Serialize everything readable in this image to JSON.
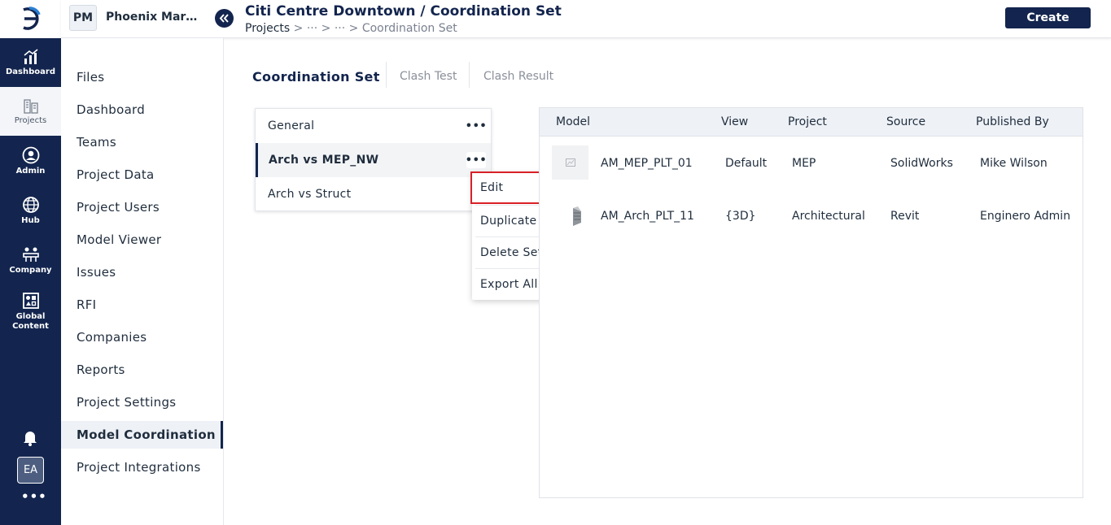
{
  "rail": {
    "items": [
      {
        "label": "Dashboard",
        "icon": "chart-icon"
      },
      {
        "label": "Projects",
        "icon": "buildings-icon"
      },
      {
        "label": "Admin",
        "icon": "user-circle-icon"
      },
      {
        "label": "Hub",
        "icon": "globe-icon"
      },
      {
        "label": "Company",
        "icon": "company-icon"
      },
      {
        "label": "Global Content",
        "icon": "shapes-icon"
      }
    ],
    "avatar": "EA",
    "more": "•••"
  },
  "header": {
    "project_badge": "PM",
    "project_name": "Phoenix Marketplace",
    "title": "Citi Centre Downtown / Coordination Set",
    "breadcrumb": {
      "first": "Projects",
      "separator": ">",
      "ellipsis": "···",
      "last": "Coordination Set"
    },
    "create_label": "Create"
  },
  "sidenav": {
    "items": [
      "Files",
      "Dashboard",
      "Teams",
      "Project Data",
      "Project Users",
      "Model Viewer",
      "Issues",
      "RFI",
      "Companies",
      "Reports",
      "Project Settings",
      "Model Coordination",
      "Project Integrations"
    ],
    "active": "Model Coordination"
  },
  "tabs": [
    {
      "label": "Coordination Set",
      "active": true
    },
    {
      "label": "Clash Test",
      "active": false
    },
    {
      "label": "Clash Result",
      "active": false
    }
  ],
  "sets": [
    {
      "name": "General",
      "more": "•••"
    },
    {
      "name": "Arch vs MEP_NW",
      "more": "•••",
      "selected": true
    },
    {
      "name": "Arch vs Struct"
    }
  ],
  "context_menu": {
    "items": [
      "Edit",
      "Duplicate Set",
      "Delete Set",
      "Export All as Excel"
    ],
    "display": [
      "Edit",
      "Duplicate Set",
      "Delete Set",
      "Export All a···"
    ],
    "highlighted": "Edit"
  },
  "models": {
    "columns": [
      "Model",
      "View",
      "Project",
      "Source",
      "Published By"
    ],
    "rows": [
      {
        "model": "AM_MEP_PLT_01",
        "view": "Default",
        "project": "MEP",
        "source": "SolidWorks",
        "published_by": "Mike Wilson"
      },
      {
        "model": "AM_Arch_PLT_11",
        "view": "{3D}",
        "project": "Architectural",
        "source": "Revit",
        "published_by": "Enginero Admin"
      }
    ]
  },
  "colors": {
    "navy": "#13254e",
    "highlight_border": "#d92027"
  }
}
